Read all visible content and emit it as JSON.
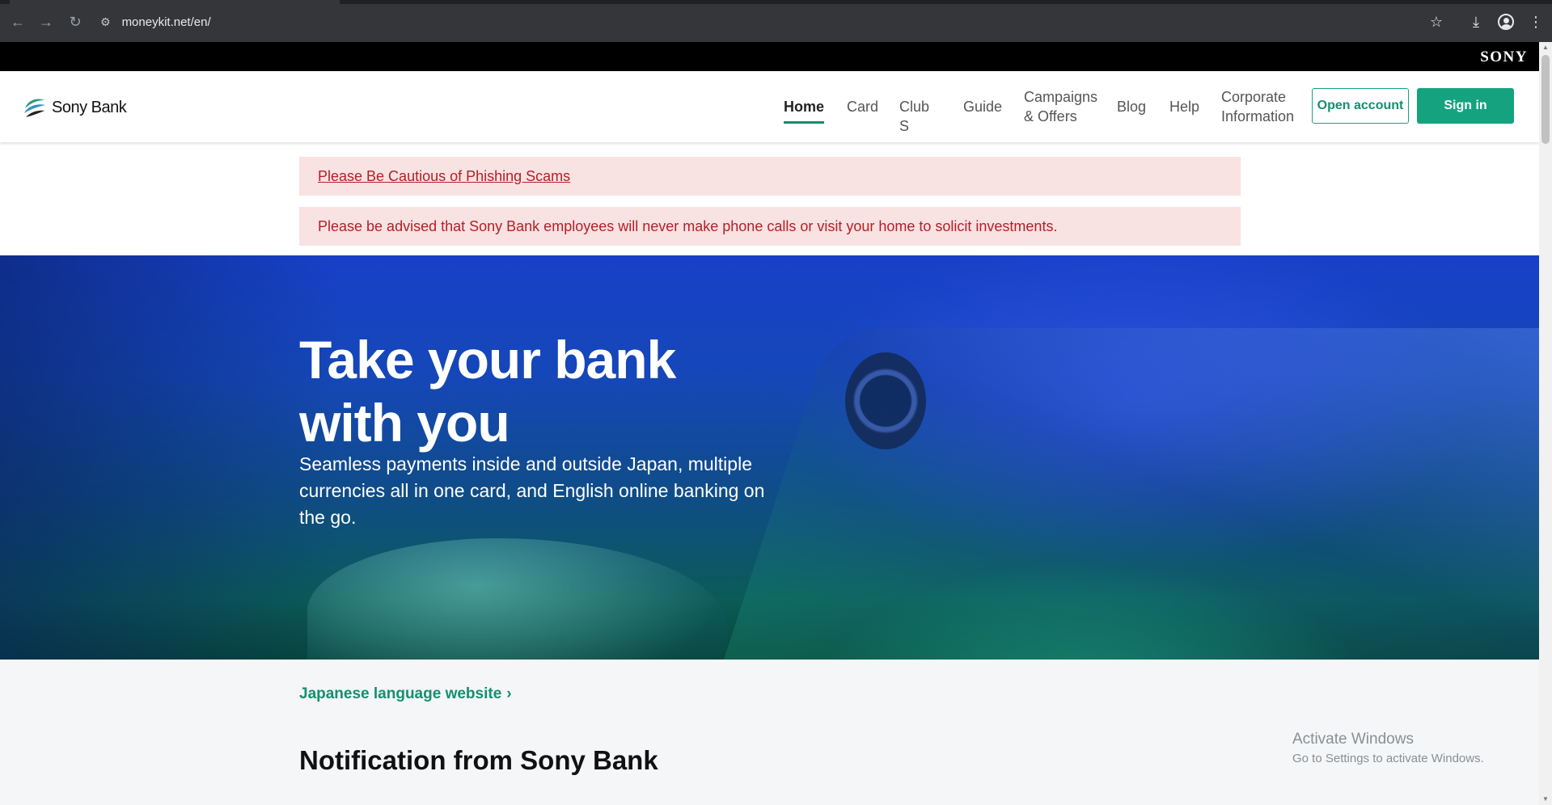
{
  "browser": {
    "url": "moneykit.net/en/",
    "icons": [
      "back-icon",
      "forward-icon",
      "reload-icon",
      "site-info-icon",
      "star-icon",
      "download-icon",
      "profile-icon",
      "more-icon"
    ]
  },
  "sony_strip": {
    "logo": "SONY"
  },
  "header": {
    "brand": "Sony Bank",
    "nav": [
      {
        "label": "Home",
        "active": true
      },
      {
        "label": "Card"
      },
      {
        "label": "Club S"
      },
      {
        "label": "Guide"
      },
      {
        "label_line1": "Campaigns",
        "label_line2": "& Offers"
      },
      {
        "label": "Blog"
      },
      {
        "label": "Help"
      },
      {
        "label_line1": "Corporate",
        "label_line2": "Information"
      }
    ],
    "open_account": "Open account",
    "sign_in": "Sign in"
  },
  "alerts": {
    "phishing": "Please Be Cautious of Phishing Scams",
    "advisory": "Please be advised that Sony Bank employees will never make phone calls or visit your home to solicit investments."
  },
  "hero": {
    "title_line1": "Take your bank",
    "title_line2": "with you",
    "subtitle": "Seamless payments inside and outside Japan, multiple currencies all in one card, and English online banking on the go."
  },
  "content": {
    "japanese_link": "Japanese language website",
    "notification_title": "Notification from Sony Bank"
  },
  "os_watermark": {
    "line1": "Activate Windows",
    "line2": "Go to Settings to activate Windows."
  },
  "colors": {
    "accent_green": "#15a37f",
    "alert_bg": "#f9e2e2",
    "alert_text": "#b42027",
    "hero_blue": "#1740c8"
  }
}
